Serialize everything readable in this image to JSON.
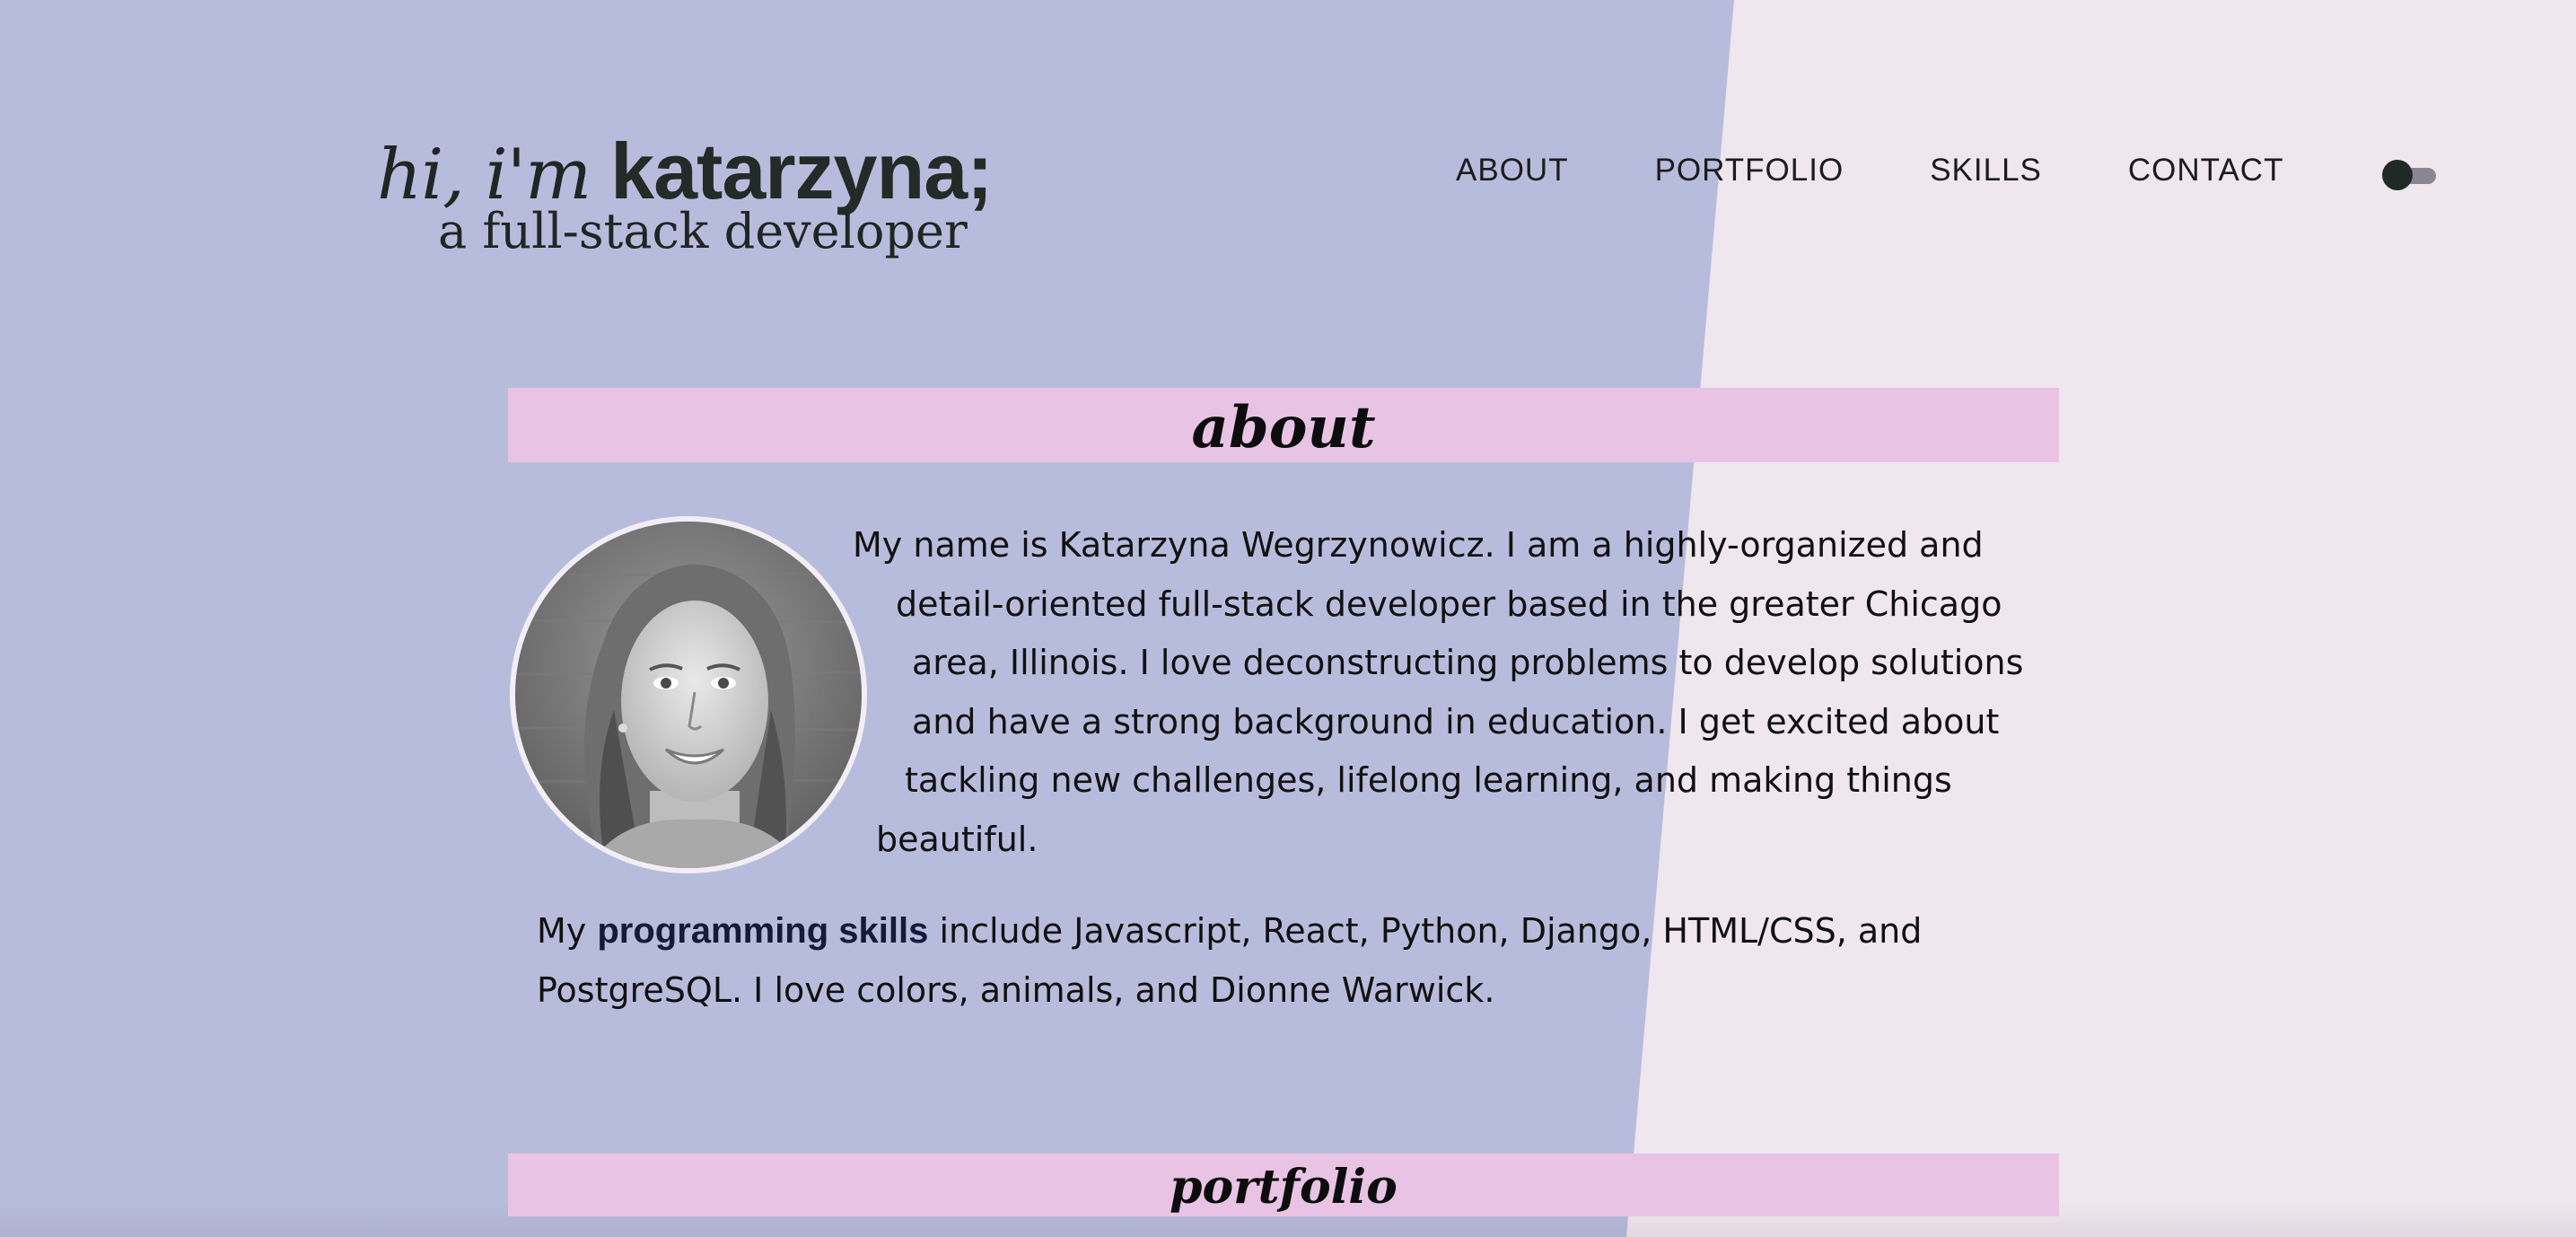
{
  "brand": {
    "greeting": "hi, i'm",
    "name": "katarzyna;",
    "tagline": "a full-stack developer"
  },
  "nav": {
    "items": [
      {
        "label": "ABOUT"
      },
      {
        "label": "PORTFOLIO"
      },
      {
        "label": "SKILLS"
      },
      {
        "label": "CONTACT"
      }
    ],
    "theme_toggle": "dark-mode-toggle"
  },
  "sections": {
    "about": {
      "title": "about",
      "bio_lines": [
        "My name is Katarzyna Wegrzynowicz. I am a highly-organized and",
        "detail-oriented full-stack developer based in the greater Chicago",
        "area, Illinois. I love deconstructing problems to develop solutions",
        "and have a strong background in education. I get excited about",
        "tackling new challenges, lifelong learning, and making things",
        "beautiful."
      ],
      "skills_prefix": "My",
      "skills_emphasis": "programming skills",
      "skills_line1_rest": " include Javascript, React, Python, Django, HTML/CSS, and",
      "skills_line2": "PostgreSQL. I love colors, animals, and Dionne Warwick."
    },
    "portfolio": {
      "title": "portfolio"
    }
  },
  "colors": {
    "left_panel": "#b8bcdc",
    "right_panel": "#efe6ee",
    "banner": "#e8c3e4",
    "heading_text": "#222b27"
  },
  "avatar": {
    "image": "portrait-photo"
  }
}
